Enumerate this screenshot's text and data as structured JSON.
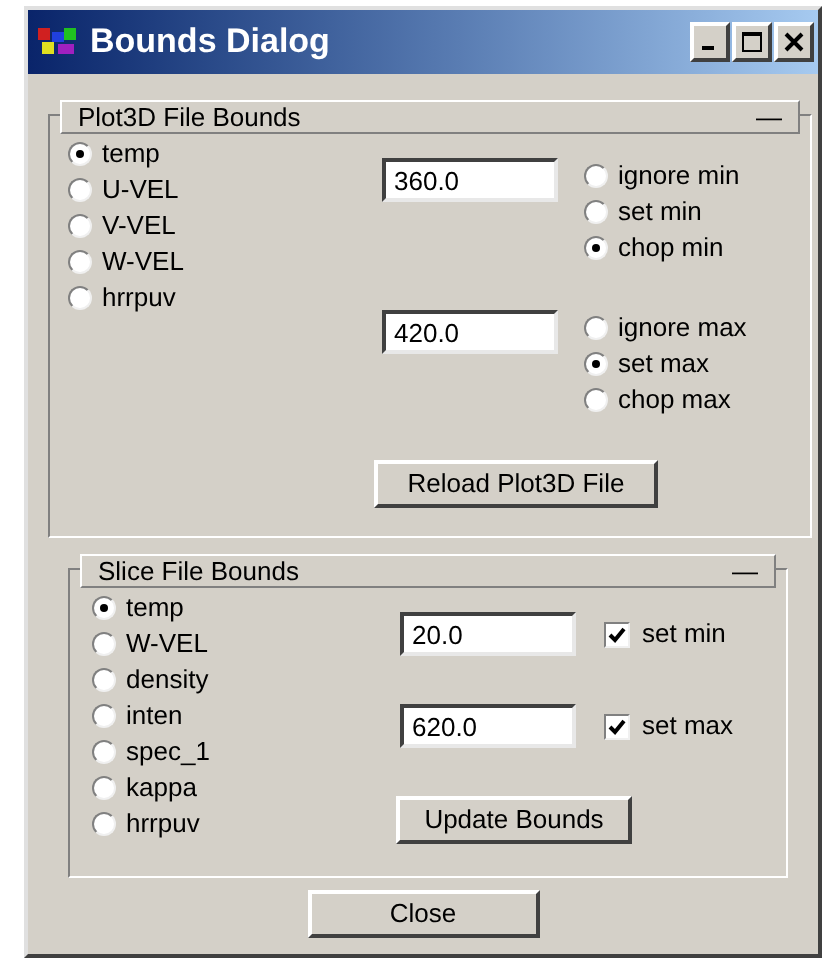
{
  "window": {
    "title": "Bounds Dialog"
  },
  "plot3d_panel": {
    "title": "Plot3D File Bounds",
    "collapse": "—",
    "variables": [
      {
        "label": "temp",
        "selected": true
      },
      {
        "label": "U-VEL",
        "selected": false
      },
      {
        "label": "V-VEL",
        "selected": false
      },
      {
        "label": "W-VEL",
        "selected": false
      },
      {
        "label": "hrrpuv",
        "selected": false
      }
    ],
    "min": {
      "value": "360.0",
      "options": [
        {
          "label": "ignore min",
          "selected": false
        },
        {
          "label": "set min",
          "selected": false
        },
        {
          "label": "chop min",
          "selected": true
        }
      ]
    },
    "max": {
      "value": "420.0",
      "options": [
        {
          "label": "ignore max",
          "selected": false
        },
        {
          "label": "set max",
          "selected": true
        },
        {
          "label": "chop max",
          "selected": false
        }
      ]
    },
    "reload_button": "Reload Plot3D File"
  },
  "slice_panel": {
    "title": "Slice File Bounds",
    "collapse": "—",
    "variables": [
      {
        "label": "temp",
        "selected": true
      },
      {
        "label": "W-VEL",
        "selected": false
      },
      {
        "label": "density",
        "selected": false
      },
      {
        "label": "inten",
        "selected": false
      },
      {
        "label": "spec_1",
        "selected": false
      },
      {
        "label": "kappa",
        "selected": false
      },
      {
        "label": "hrrpuv",
        "selected": false
      }
    ],
    "min": {
      "value": "20.0",
      "label": "set min",
      "checked": true
    },
    "max": {
      "value": "620.0",
      "label": "set max",
      "checked": true
    },
    "update_button": "Update Bounds"
  },
  "close_button": "Close"
}
